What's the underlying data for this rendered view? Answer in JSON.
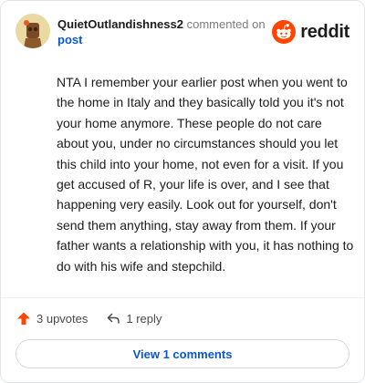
{
  "comment": {
    "username": "QuietOutlandishness2",
    "action_text": "commented on",
    "post_link": "post",
    "body": "NTA I remember your earlier post when you went to the home in Italy and they basically told you it's not your home anymore. These people do not care about you, under no circumstances should you let this child into your home, not even for a visit. If you get accused of R, your life is over, and I see that happening very easily. Look out for yourself, don't send them anything, stay away from them. If your father wants a relationship with you, it has nothing to do with his wife and stepchild."
  },
  "brand": {
    "name": "reddit",
    "logo_icon": "reddit-snoo-icon",
    "accent_color": "#ff4500"
  },
  "actions": {
    "upvotes_label": "3 upvotes",
    "upvote_icon": "upvote-arrow-icon",
    "reply_label": "1 reply",
    "reply_icon": "reply-arrow-icon"
  },
  "footer": {
    "view_comments_label": "View 1 comments"
  }
}
